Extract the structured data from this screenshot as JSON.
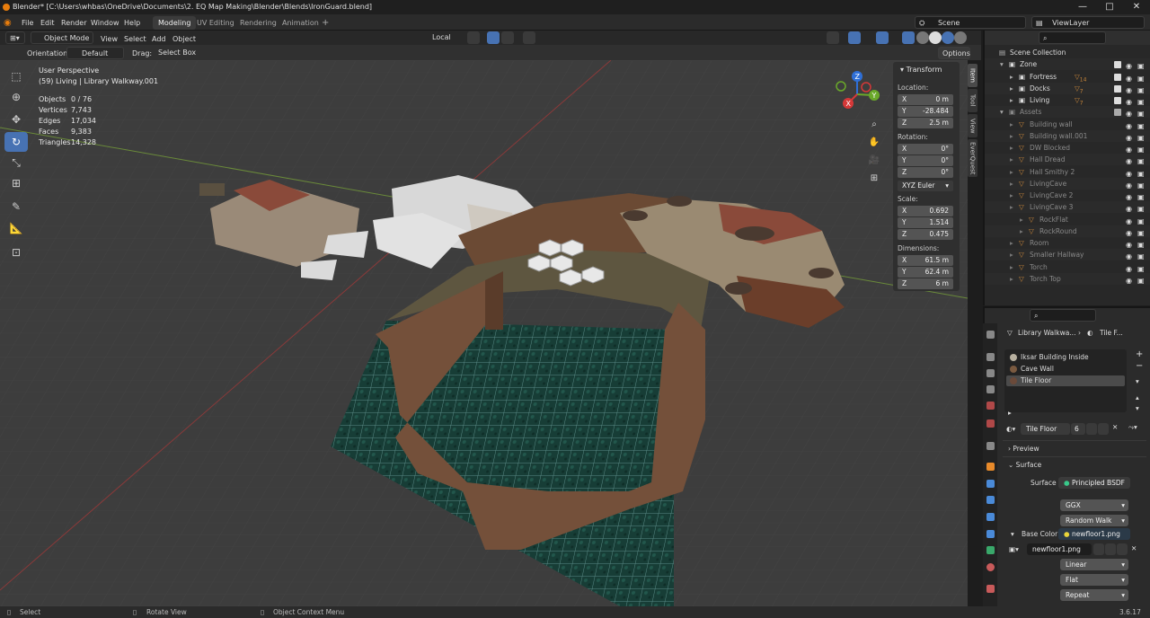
{
  "titlebar": {
    "title": "Blender* [C:\\Users\\whbas\\OneDrive\\Documents\\2. EQ Map Making\\Blender\\Blends\\IronGuard.blend]",
    "minimize": "—",
    "maximize": "□",
    "close": "✕"
  },
  "menu": {
    "file": "File",
    "edit": "Edit",
    "render": "Render",
    "window": "Window",
    "help": "Help"
  },
  "workspaces": [
    "Modeling",
    "UV Editing",
    "Rendering",
    "Animation",
    "+"
  ],
  "scene": {
    "label": "Scene",
    "viewlayer": "ViewLayer"
  },
  "header3d": {
    "mode": "Object Mode",
    "view": "View",
    "select": "Select",
    "add": "Add",
    "object": "Object",
    "transform": "Local",
    "orientation_label": "Orientation:",
    "orientation": "Default",
    "drag_label": "Drag:",
    "drag": "Select Box",
    "options": "Options"
  },
  "overlay": {
    "perspective": "User Perspective",
    "context": "(59) Living | Library Walkway.001",
    "stats": [
      {
        "k": "Objects",
        "v": "0 / 76"
      },
      {
        "k": "Vertices",
        "v": "7,743"
      },
      {
        "k": "Edges",
        "v": "17,034"
      },
      {
        "k": "Faces",
        "v": "9,383"
      },
      {
        "k": "Triangles",
        "v": "14,328"
      }
    ]
  },
  "gizmo": {
    "z": "Z",
    "y": "Y",
    "x": "X"
  },
  "npanel": {
    "title": "Transform",
    "location_label": "Location:",
    "location": {
      "x": "0 m",
      "y": "-28.484",
      "z": "2.5 m"
    },
    "rotation_label": "Rotation:",
    "rotation": {
      "x": "0°",
      "y": "0°",
      "z": "0°"
    },
    "rotation_mode": "XYZ Euler",
    "scale_label": "Scale:",
    "scale": {
      "x": "0.692",
      "y": "1.514",
      "z": "0.475"
    },
    "dimensions_label": "Dimensions:",
    "dimensions": {
      "x": "61.5 m",
      "y": "62.4 m",
      "z": "6 m"
    },
    "tabs": [
      "Item",
      "Tool",
      "View",
      "EverQuest"
    ]
  },
  "outliner": {
    "rows": [
      {
        "name": "Scene Collection",
        "indent": 0,
        "type": "scene"
      },
      {
        "name": "Zone",
        "indent": 1,
        "type": "coll"
      },
      {
        "name": "Fortress",
        "indent": 2,
        "type": "coll",
        "badge": "14"
      },
      {
        "name": "Docks",
        "indent": 2,
        "type": "coll",
        "badge": "7"
      },
      {
        "name": "Living",
        "indent": 2,
        "type": "coll",
        "badge": "7"
      },
      {
        "name": "Assets",
        "indent": 1,
        "type": "coll",
        "dim": true
      },
      {
        "name": "Building wall",
        "indent": 2,
        "type": "obj",
        "dim": true
      },
      {
        "name": "Building wall.001",
        "indent": 2,
        "type": "obj",
        "dim": true
      },
      {
        "name": "DW Blocked",
        "indent": 2,
        "type": "obj",
        "dim": true
      },
      {
        "name": "Hall Dread",
        "indent": 2,
        "type": "obj",
        "dim": true
      },
      {
        "name": "Hall Smithy 2",
        "indent": 2,
        "type": "obj",
        "dim": true
      },
      {
        "name": "LivingCave",
        "indent": 2,
        "type": "obj",
        "dim": true
      },
      {
        "name": "LivingCave 2",
        "indent": 2,
        "type": "obj",
        "dim": true
      },
      {
        "name": "LivingCave 3",
        "indent": 2,
        "type": "obj",
        "dim": true
      },
      {
        "name": "RockFlat",
        "indent": 3,
        "type": "obj",
        "dim": true
      },
      {
        "name": "RockRound",
        "indent": 3,
        "type": "obj",
        "dim": true
      },
      {
        "name": "Room",
        "indent": 2,
        "type": "obj",
        "dim": true
      },
      {
        "name": "Smaller Hallway",
        "indent": 2,
        "type": "obj",
        "dim": true
      },
      {
        "name": "Torch",
        "indent": 2,
        "type": "obj",
        "dim": true
      },
      {
        "name": "Torch Top",
        "indent": 2,
        "type": "obj",
        "dim": true
      }
    ]
  },
  "properties": {
    "breadcrumb_obj": "Library Walkwa...",
    "breadcrumb_mat": "Tile F...",
    "materials": [
      {
        "name": "Iksar Building Inside",
        "color": "#b8b0a0"
      },
      {
        "name": "Cave Wall",
        "color": "#7a5a40"
      },
      {
        "name": "Tile Floor",
        "color": "#6b4a3a"
      }
    ],
    "active_material": "Tile Floor",
    "users": "6",
    "preview": "Preview",
    "surface_section": "Surface",
    "surface_label": "Surface",
    "surface_value": "Principled BSDF",
    "distribution": "GGX",
    "subsurface": "Random Walk",
    "base_color_label": "Base Color",
    "base_color_value": "newfloor1.png",
    "image_name": "newfloor1.png",
    "interp": "Linear",
    "projection": "Flat",
    "extension": "Repeat"
  },
  "statusbar": {
    "select": "Select",
    "rotate": "Rotate View",
    "context": "Object Context Menu",
    "version": "3.6.17"
  }
}
